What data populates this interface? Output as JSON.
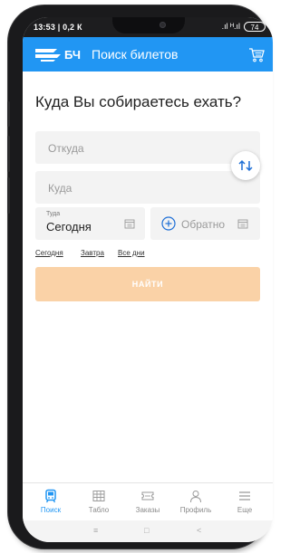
{
  "status_bar": {
    "time": "13:53 | 0,2 К",
    "signal": ".ıl ᴴ.ıl",
    "battery": "74"
  },
  "header": {
    "brand": "БЧ",
    "title": "Поиск билетов",
    "accent": "#2196f3"
  },
  "form": {
    "heading": "Куда Вы собираетесь ехать?",
    "from_placeholder": "Откуда",
    "to_placeholder": "Куда",
    "there_label": "Туда",
    "there_value": "Сегодня",
    "back_label": "Обратно",
    "quick_dates": [
      "Сегодня",
      "Завтра",
      "Все дни"
    ],
    "search_button": "НАЙТИ",
    "button_color": "#fad2a7"
  },
  "bottom_nav": [
    {
      "label": "Поиск",
      "icon": "train-icon",
      "active": true
    },
    {
      "label": "Табло",
      "icon": "board-icon",
      "active": false
    },
    {
      "label": "Заказы",
      "icon": "ticket-icon",
      "active": false
    },
    {
      "label": "Профиль",
      "icon": "profile-icon",
      "active": false
    },
    {
      "label": "Еще",
      "icon": "menu-icon",
      "active": false
    }
  ],
  "system_nav": {
    "menu": "≡",
    "home": "□",
    "back": "<"
  }
}
